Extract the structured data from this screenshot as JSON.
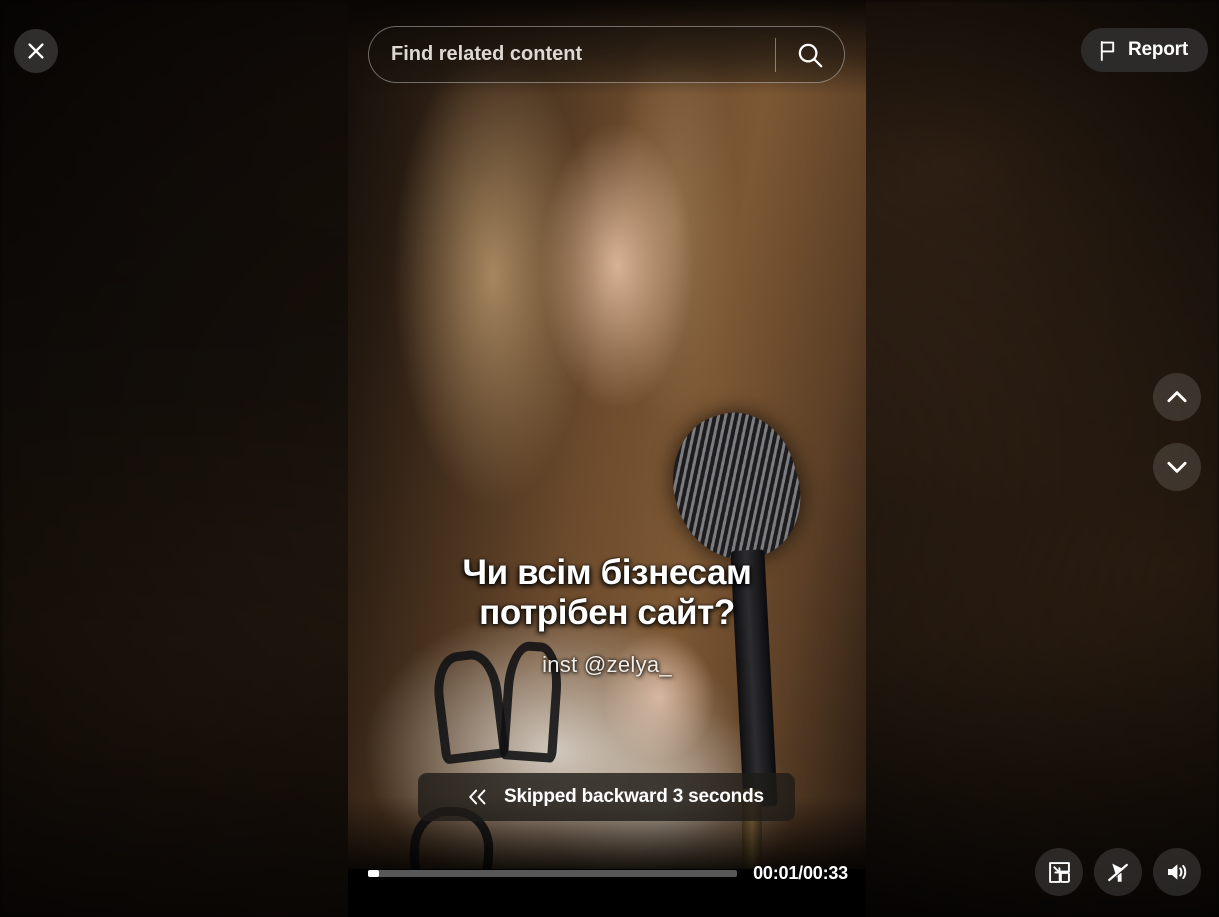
{
  "viewer": {
    "close_button_label": "Close",
    "close_icon": "close-icon"
  },
  "search": {
    "placeholder": "Find related content",
    "value": "",
    "icon": "search-icon"
  },
  "report": {
    "label": "Report",
    "icon": "flag-icon"
  },
  "navigation": {
    "previous_label": "Previous video",
    "previous_icon": "chevron-up-icon",
    "next_label": "Next video",
    "next_icon": "chevron-down-icon"
  },
  "video": {
    "caption_line_1": "Чи всім бізнесам",
    "caption_line_2": "потрібен сайт?",
    "handle": "inst @zelya_"
  },
  "toast": {
    "message": "Skipped backward 3 seconds",
    "icon": "chevrons-left-icon"
  },
  "player": {
    "time_display": "00:01/00:33",
    "current_time": "00:01",
    "duration": "00:33",
    "progress_percent": 3
  },
  "controls": [
    {
      "name": "picture-in-picture-button",
      "icon": "picture-in-picture-icon",
      "label": "Picture in picture"
    },
    {
      "name": "autoscroll-off-button",
      "icon": "cursor-slash-icon",
      "label": "Autoscroll off"
    },
    {
      "name": "volume-button",
      "icon": "volume-high-icon",
      "label": "Volume"
    }
  ],
  "colors": {
    "overlay_dark": "#1e1b18",
    "accent_white": "#ffffff",
    "backdrop": "#0a0705",
    "report_pill": "#302e2c"
  }
}
